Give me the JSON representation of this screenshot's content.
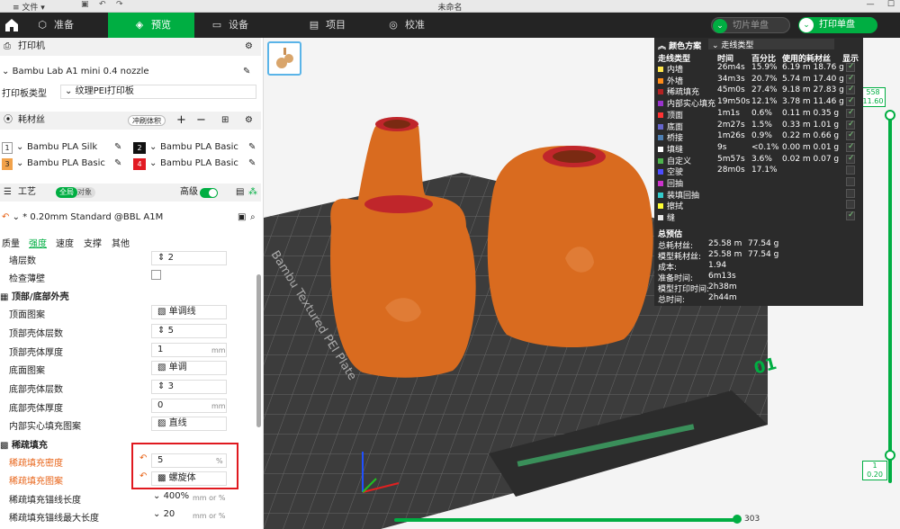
{
  "titlebar": {
    "file_menu": "文件",
    "title": "未命名"
  },
  "nav": {
    "tabs": [
      {
        "label": "准备"
      },
      {
        "label": "预览"
      },
      {
        "label": "设备"
      },
      {
        "label": "项目"
      },
      {
        "label": "校准"
      }
    ],
    "slice_plate": "切片单盘",
    "print_plate": "打印单盘"
  },
  "printer": {
    "section": "打印机",
    "name": "Bambu Lab A1 mini 0.4 nozzle",
    "plate_label": "打印板类型",
    "plate_value": "纹理PEI打印板"
  },
  "filament": {
    "section": "耗材丝",
    "flush_badge": "冲刷体积",
    "items": [
      {
        "index": "1",
        "name": "Bambu PLA Silk",
        "color": "#ffffff"
      },
      {
        "index": "2",
        "name": "Bambu PLA Basic",
        "color": "#111111"
      },
      {
        "index": "3",
        "name": "Bambu PLA Basic",
        "color": "#f2a24a"
      },
      {
        "index": "4",
        "name": "Bambu PLA Basic",
        "color": "#e21b23"
      }
    ]
  },
  "process": {
    "section": "工艺",
    "toggle_global": "全局",
    "toggle_object": "对象",
    "advanced": "高级",
    "preset": "* 0.20mm Standard @BBL A1M",
    "tabs": [
      "质量",
      "强度",
      "速度",
      "支撑",
      "其他"
    ],
    "params": [
      {
        "label": "墙层数",
        "value": "2"
      },
      {
        "label": "检查薄壁",
        "value": ""
      }
    ],
    "top_bottom": {
      "header": "顶部/底部外壳",
      "rows": [
        {
          "label": "顶面图案",
          "value": "单调线"
        },
        {
          "label": "顶部壳体层数",
          "value": "5"
        },
        {
          "label": "顶部壳体厚度",
          "value": "1",
          "unit": "mm"
        },
        {
          "label": "底面图案",
          "value": "单调"
        },
        {
          "label": "底部壳体层数",
          "value": "3"
        },
        {
          "label": "底部壳体厚度",
          "value": "0",
          "unit": "mm"
        },
        {
          "label": "内部实心填充图案",
          "value": "直线"
        }
      ]
    },
    "sparse": {
      "header": "稀疏填充",
      "rows": [
        {
          "label": "稀疏填充密度",
          "value": "5",
          "unit": "%"
        },
        {
          "label": "稀疏填充图案",
          "value": "螺旋体"
        },
        {
          "label": "稀疏填充锚线长度",
          "value": "400%",
          "unit": "mm or %"
        },
        {
          "label": "稀疏填充锚线最大长度",
          "value": "20",
          "unit": "mm or %"
        }
      ]
    }
  },
  "plate_text": "Bambu Textured PEI Plate",
  "plate_number": "01",
  "stats": {
    "scheme_label": "颜色方案",
    "scheme_value": "走线类型",
    "headers": [
      "走线类型",
      "时间",
      "百分比",
      "使用的耗材丝",
      "显示"
    ],
    "rows": [
      {
        "name": "内墙",
        "time": "26m4s",
        "pct": "15.9%",
        "used": "6.19 m 18.76 g",
        "color": "#ffe64d",
        "shown": true
      },
      {
        "name": "外墙",
        "time": "34m3s",
        "pct": "20.7%",
        "used": "5.74 m 17.40 g",
        "color": "#ff8c1a",
        "shown": true
      },
      {
        "name": "稀疏填充",
        "time": "45m0s",
        "pct": "27.4%",
        "used": "9.18 m 27.83 g",
        "color": "#b22222",
        "shown": true
      },
      {
        "name": "内部实心填充",
        "time": "19m50s",
        "pct": "12.1%",
        "used": "3.78 m 11.46 g",
        "color": "#9933cc",
        "shown": true
      },
      {
        "name": "顶面",
        "time": "1m1s",
        "pct": "0.6%",
        "used": "0.11 m 0.35 g",
        "color": "#ff3333",
        "shown": true
      },
      {
        "name": "底面",
        "time": "2m27s",
        "pct": "1.5%",
        "used": "0.33 m 1.01 g",
        "color": "#6666cc",
        "shown": true
      },
      {
        "name": "桥接",
        "time": "1m26s",
        "pct": "0.9%",
        "used": "0.22 m 0.66 g",
        "color": "#4d7fb3",
        "shown": true
      },
      {
        "name": "填缝",
        "time": "9s",
        "pct": "<0.1%",
        "used": "0.00 m 0.01 g",
        "color": "#ffffff",
        "shown": true
      },
      {
        "name": "自定义",
        "time": "5m57s",
        "pct": "3.6%",
        "used": "0.02 m 0.07 g",
        "color": "#4db34d",
        "shown": true
      },
      {
        "name": "空驶",
        "time": "28m0s",
        "pct": "17.1%",
        "used": "",
        "color": "#4d4dff",
        "shown": false
      },
      {
        "name": "回抽",
        "time": "",
        "pct": "",
        "used": "",
        "color": "#cc33cc",
        "shown": false
      },
      {
        "name": "装填回抽",
        "time": "",
        "pct": "",
        "used": "",
        "color": "#33cccc",
        "shown": false
      },
      {
        "name": "擦拭",
        "time": "",
        "pct": "",
        "used": "",
        "color": "#ffff33",
        "shown": false
      },
      {
        "name": "缝",
        "time": "",
        "pct": "",
        "used": "",
        "color": "#e6e6e6",
        "shown": true
      }
    ],
    "summary_title": "总预估",
    "summary": [
      {
        "label": "总耗材丝:",
        "a": "25.58 m",
        "b": "77.54 g"
      },
      {
        "label": "模型耗材丝:",
        "a": "25.58 m",
        "b": "77.54 g"
      },
      {
        "label": "成本:",
        "a": "1.94",
        "b": ""
      },
      {
        "label": "准备时间:",
        "a": "6m13s",
        "b": ""
      },
      {
        "label": "模型打印时间:",
        "a": "2h38m",
        "b": ""
      },
      {
        "label": "总时间:",
        "a": "2h44m",
        "b": ""
      }
    ]
  },
  "layer_slider": {
    "top_a": "558",
    "top_b": "11.60",
    "bottom_a": "1",
    "bottom_b": "0.20"
  },
  "move_slider": {
    "value": "303"
  }
}
